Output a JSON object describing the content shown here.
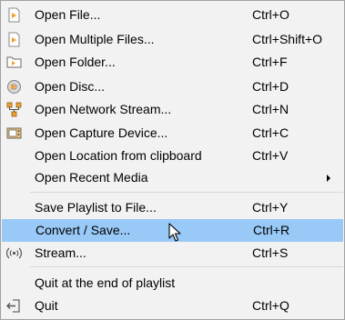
{
  "menu": {
    "items": [
      {
        "label": "Open File...",
        "shortcut": "Ctrl+O",
        "icon": "media-file-icon"
      },
      {
        "label": "Open Multiple Files...",
        "shortcut": "Ctrl+Shift+O",
        "icon": "media-file-icon"
      },
      {
        "label": "Open Folder...",
        "shortcut": "Ctrl+F",
        "icon": "folder-icon"
      },
      {
        "label": "Open Disc...",
        "shortcut": "Ctrl+D",
        "icon": "disc-icon"
      },
      {
        "label": "Open Network Stream...",
        "shortcut": "Ctrl+N",
        "icon": "network-icon"
      },
      {
        "label": "Open Capture Device...",
        "shortcut": "Ctrl+C",
        "icon": "capture-device-icon"
      },
      {
        "label": "Open Location from clipboard",
        "shortcut": "Ctrl+V",
        "icon": ""
      },
      {
        "label": "Open Recent Media",
        "shortcut": "",
        "icon": "",
        "submenu": true
      },
      {
        "label": "Save Playlist to File...",
        "shortcut": "Ctrl+Y",
        "icon": ""
      },
      {
        "label": "Convert / Save...",
        "shortcut": "Ctrl+R",
        "icon": "",
        "highlighted": true
      },
      {
        "label": "Stream...",
        "shortcut": "Ctrl+S",
        "icon": "stream-icon"
      },
      {
        "label": "Quit at the end of playlist",
        "shortcut": "",
        "icon": ""
      },
      {
        "label": "Quit",
        "shortcut": "Ctrl+Q",
        "icon": "quit-icon"
      }
    ]
  },
  "colors": {
    "background": "#f2f2f2",
    "highlight": "#99c9f7",
    "icon_orange": "#f0a030",
    "separator": "#d7d7d7"
  }
}
